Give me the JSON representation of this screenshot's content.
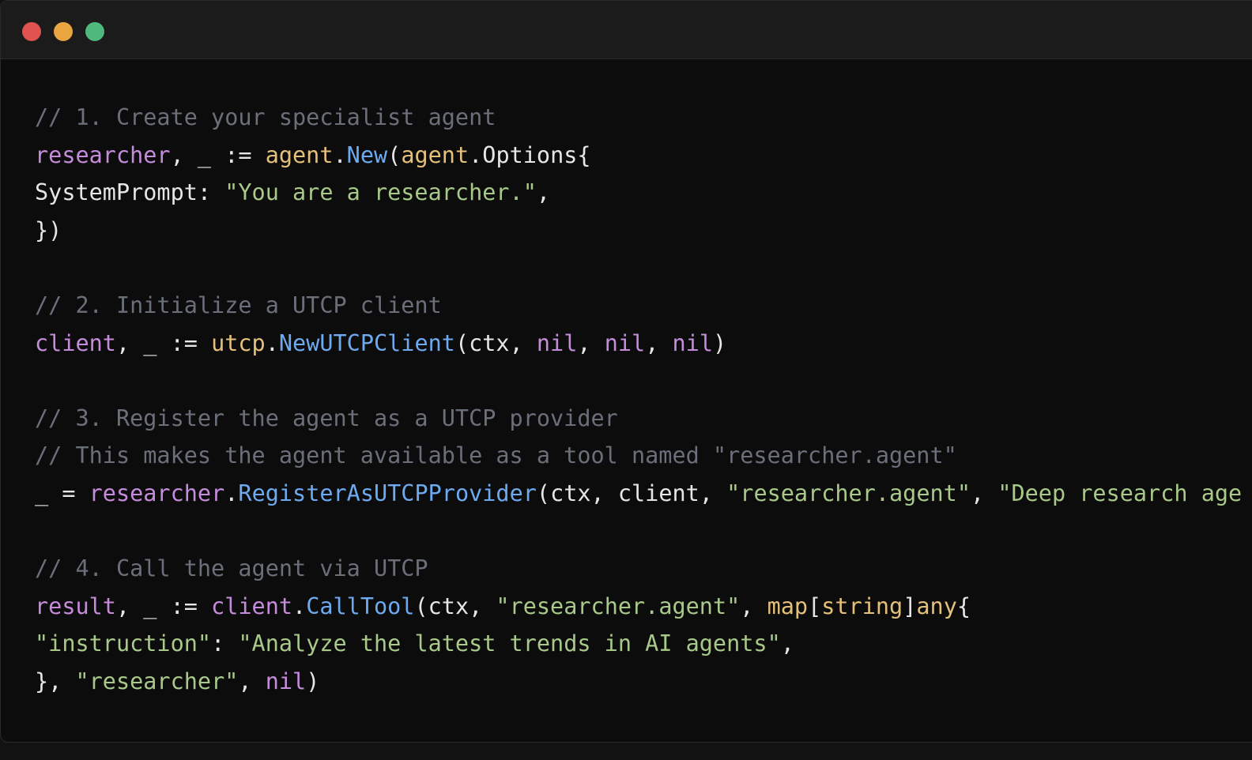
{
  "window": {
    "traffic_lights": [
      {
        "name": "close",
        "color": "#e0534e"
      },
      {
        "name": "minimize",
        "color": "#e9a53f"
      },
      {
        "name": "zoom",
        "color": "#4fb87d"
      }
    ]
  },
  "colors": {
    "comment": "#6b6f7a",
    "variable": "#c68cdc",
    "type": "#e5c07b",
    "function": "#6eaaf0",
    "string": "#a8c98a",
    "plain": "#e6e6e6",
    "background": "#0c0c0c",
    "titlebar": "#1b1b1b"
  },
  "code": {
    "lines": [
      [
        {
          "t": "// 1. Create your specialist agent",
          "c": "comment"
        }
      ],
      [
        {
          "t": "researcher",
          "c": "variable"
        },
        {
          "t": ", _ := ",
          "c": "plain"
        },
        {
          "t": "agent",
          "c": "type"
        },
        {
          "t": ".",
          "c": "plain"
        },
        {
          "t": "New",
          "c": "function"
        },
        {
          "t": "(",
          "c": "plain"
        },
        {
          "t": "agent",
          "c": "type"
        },
        {
          "t": ".Options{",
          "c": "plain"
        }
      ],
      [
        {
          "t": "SystemPrompt: ",
          "c": "plain"
        },
        {
          "t": "\"You are a researcher.\"",
          "c": "string"
        },
        {
          "t": ",",
          "c": "plain"
        }
      ],
      [
        {
          "t": "})",
          "c": "plain"
        }
      ],
      [],
      [
        {
          "t": "// 2. Initialize a UTCP client",
          "c": "comment"
        }
      ],
      [
        {
          "t": "client",
          "c": "variable"
        },
        {
          "t": ", _ := ",
          "c": "plain"
        },
        {
          "t": "utcp",
          "c": "type"
        },
        {
          "t": ".",
          "c": "plain"
        },
        {
          "t": "NewUTCPClient",
          "c": "function"
        },
        {
          "t": "(ctx, ",
          "c": "plain"
        },
        {
          "t": "nil",
          "c": "variable"
        },
        {
          "t": ", ",
          "c": "plain"
        },
        {
          "t": "nil",
          "c": "variable"
        },
        {
          "t": ", ",
          "c": "plain"
        },
        {
          "t": "nil",
          "c": "variable"
        },
        {
          "t": ")",
          "c": "plain"
        }
      ],
      [],
      [
        {
          "t": "// 3. Register the agent as a UTCP provider",
          "c": "comment"
        }
      ],
      [
        {
          "t": "// This makes the agent available as a tool named \"researcher.agent\"",
          "c": "comment"
        }
      ],
      [
        {
          "t": "_ = ",
          "c": "plain"
        },
        {
          "t": "researcher",
          "c": "variable"
        },
        {
          "t": ".",
          "c": "plain"
        },
        {
          "t": "RegisterAsUTCPProvider",
          "c": "function"
        },
        {
          "t": "(ctx, client, ",
          "c": "plain"
        },
        {
          "t": "\"researcher.agent\"",
          "c": "string"
        },
        {
          "t": ", ",
          "c": "plain"
        },
        {
          "t": "\"Deep research age",
          "c": "string"
        }
      ],
      [],
      [
        {
          "t": "// 4. Call the agent via UTCP",
          "c": "comment"
        }
      ],
      [
        {
          "t": "result",
          "c": "variable"
        },
        {
          "t": ", _ := ",
          "c": "plain"
        },
        {
          "t": "client",
          "c": "variable"
        },
        {
          "t": ".",
          "c": "plain"
        },
        {
          "t": "CallTool",
          "c": "function"
        },
        {
          "t": "(ctx, ",
          "c": "plain"
        },
        {
          "t": "\"researcher.agent\"",
          "c": "string"
        },
        {
          "t": ", ",
          "c": "plain"
        },
        {
          "t": "map",
          "c": "type"
        },
        {
          "t": "[",
          "c": "plain"
        },
        {
          "t": "string",
          "c": "type"
        },
        {
          "t": "]",
          "c": "plain"
        },
        {
          "t": "any",
          "c": "type"
        },
        {
          "t": "{",
          "c": "plain"
        }
      ],
      [
        {
          "t": "\"instruction\"",
          "c": "string"
        },
        {
          "t": ": ",
          "c": "plain"
        },
        {
          "t": "\"Analyze the latest trends in AI agents\"",
          "c": "string"
        },
        {
          "t": ",",
          "c": "plain"
        }
      ],
      [
        {
          "t": "}, ",
          "c": "plain"
        },
        {
          "t": "\"researcher\"",
          "c": "string"
        },
        {
          "t": ", ",
          "c": "plain"
        },
        {
          "t": "nil",
          "c": "variable"
        },
        {
          "t": ")",
          "c": "plain"
        }
      ]
    ]
  }
}
